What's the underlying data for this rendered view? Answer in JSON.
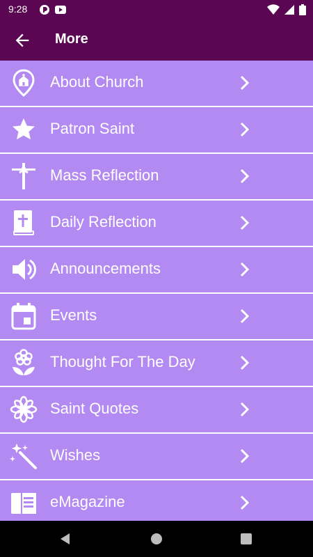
{
  "status": {
    "time": "9:28"
  },
  "header": {
    "title": "More"
  },
  "items": [
    {
      "label": "About Church",
      "icon": "church-location-icon"
    },
    {
      "label": "Patron Saint",
      "icon": "star-icon"
    },
    {
      "label": "Mass Reflection",
      "icon": "crucifix-icon"
    },
    {
      "label": "Daily Reflection",
      "icon": "bible-icon"
    },
    {
      "label": "Announcements",
      "icon": "speaker-icon"
    },
    {
      "label": "Events",
      "icon": "calendar-icon"
    },
    {
      "label": "Thought For The Day",
      "icon": "flower-icon"
    },
    {
      "label": "Saint Quotes",
      "icon": "flower-outline-icon"
    },
    {
      "label": "Wishes",
      "icon": "magic-wand-icon"
    },
    {
      "label": "eMagazine",
      "icon": "magazine-icon"
    }
  ],
  "colors": {
    "header": "#5a0652",
    "row": "#b389f2",
    "divider": "#ffffff"
  }
}
